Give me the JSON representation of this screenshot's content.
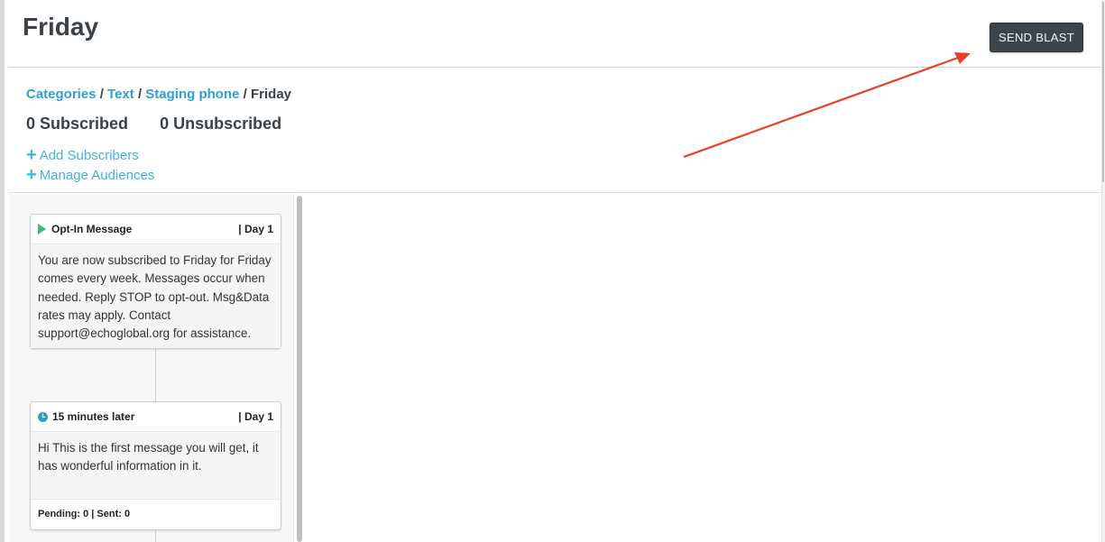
{
  "page": {
    "title": "Friday",
    "send_button_label": "SEND BLAST"
  },
  "breadcrumb": {
    "items": [
      "Categories",
      "Text",
      "Staging phone"
    ],
    "separator": "/",
    "current": "Friday"
  },
  "counts": {
    "subscribed": "0 Subscribed",
    "unsubscribed": "0 Unsubscribed"
  },
  "actions": {
    "add_subscribers": "Add Subscribers",
    "manage_audiences": "Manage Audiences"
  },
  "messages": [
    {
      "icon": "play-icon",
      "title": "Opt-In Message",
      "day": "| Day 1",
      "body": "You are now subscribed to Friday for Friday comes every week. Messages occur when needed. Reply STOP to opt-out. Msg&Data rates may apply. Contact support@echoglobal.org for assistance.",
      "footer": ""
    },
    {
      "icon": "clock-icon",
      "title": "15 minutes later",
      "day": "| Day 1",
      "body": "Hi This is the first message you will get, it has wonderful information in it.",
      "footer": "Pending: 0 | Sent: 0"
    }
  ],
  "colors": {
    "link": "#2fa0d4",
    "action": "#40b3d6",
    "button_bg": "#3d444a",
    "play_icon": "#3cba76",
    "clock_icon": "#2e9ec9",
    "annotation_arrow": "#e8402b"
  }
}
